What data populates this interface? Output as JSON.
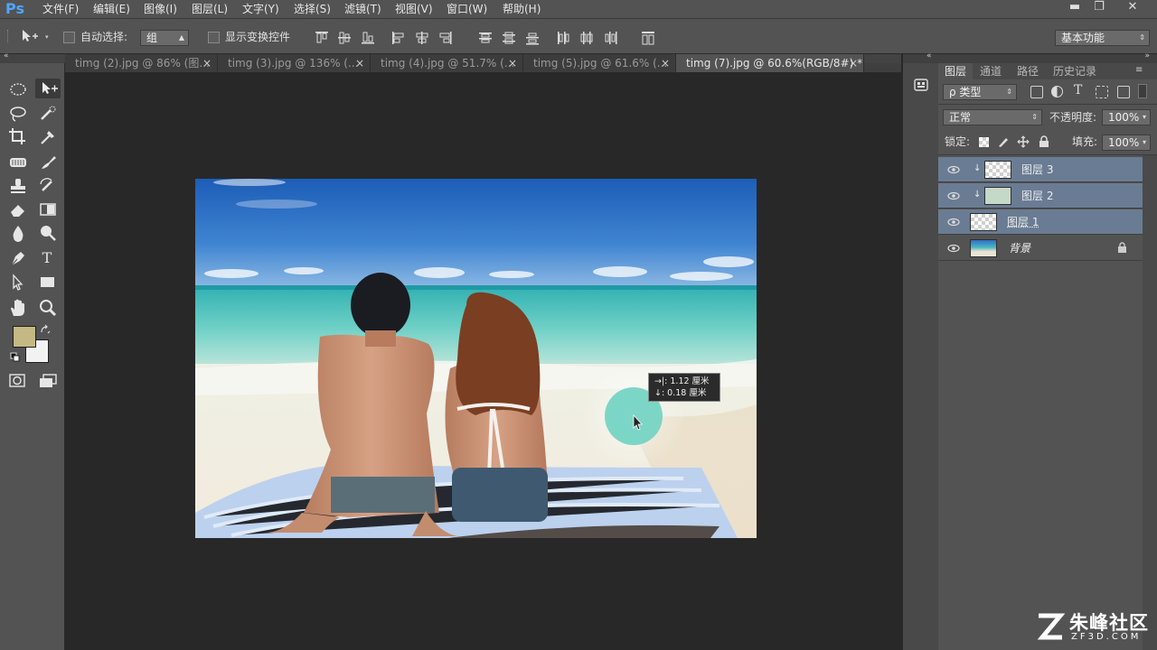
{
  "app": {
    "logo": "Ps"
  },
  "menu": [
    "文件(F)",
    "编辑(E)",
    "图像(I)",
    "图层(L)",
    "文字(Y)",
    "选择(S)",
    "滤镜(T)",
    "视图(V)",
    "窗口(W)",
    "帮助(H)"
  ],
  "window_controls": {
    "minimize": "▬",
    "restore": "❐",
    "close": "✕"
  },
  "options": {
    "auto_select_label": "自动选择:",
    "auto_select_value": "组",
    "show_transform_label": "显示变换控件",
    "workspace": "基本功能"
  },
  "tabs": [
    {
      "label": "timg (2).jpg @ 86% (图...",
      "close": "×"
    },
    {
      "label": "timg (3).jpg @ 136% (...",
      "close": "×"
    },
    {
      "label": "timg (4).jpg @ 51.7% (...",
      "close": "×"
    },
    {
      "label": "timg (5).jpg @ 61.6% (...",
      "close": "×"
    },
    {
      "label": "timg (7).jpg @ 60.6%(RGB/8#) *",
      "close": "×"
    }
  ],
  "measure": {
    "line1": "→|: 1.12 厘米",
    "line2": "↓: 0.18 厘米"
  },
  "panel": {
    "tabs": [
      "图层",
      "通道",
      "路径",
      "历史记录"
    ],
    "filter_kind": "ρ 类型",
    "blend_mode": "正常",
    "opacity_label": "不透明度:",
    "opacity_value": "100%",
    "lock_label": "锁定:",
    "fill_label": "填充:",
    "fill_value": "100%"
  },
  "layers": [
    {
      "name": "图层 3",
      "selected": true,
      "clipped": true
    },
    {
      "name": "图层 2",
      "selected": true,
      "clipped": true
    },
    {
      "name": "图层 1",
      "selected": true,
      "clipped": false
    },
    {
      "name": "背景",
      "selected": false,
      "clipped": false,
      "locked": true
    }
  ],
  "watermark": {
    "brand": "朱峰社区",
    "url": "ZF3D.COM"
  },
  "colors": {
    "foreground": "#c4b884",
    "background": "#f2f2f2",
    "accent_selection": "#6a7c93"
  }
}
